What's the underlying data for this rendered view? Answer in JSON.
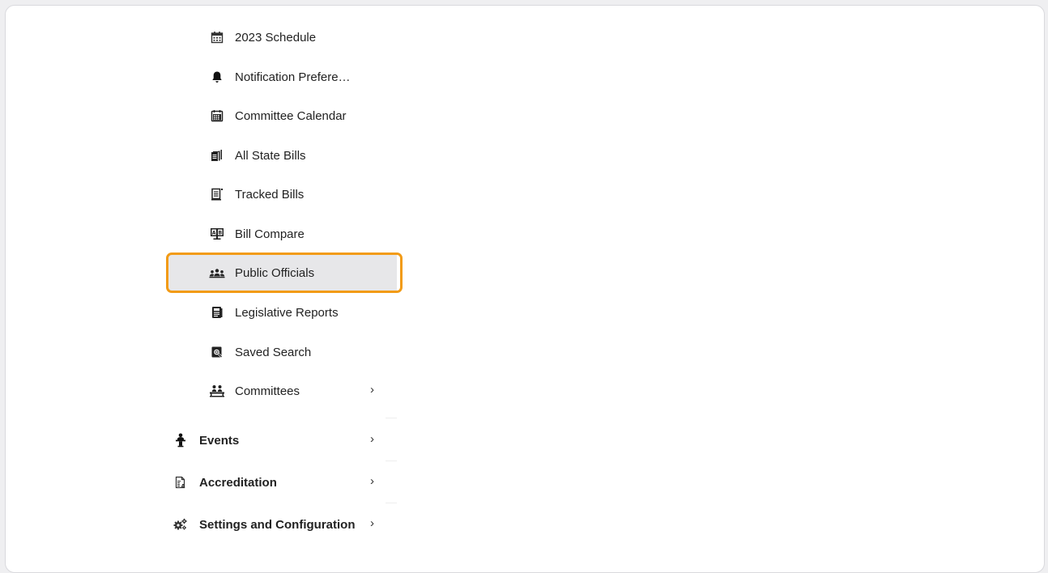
{
  "menu": {
    "items": [
      {
        "label": "2023 Schedule",
        "icon": "calendar-icon"
      },
      {
        "label": "Notification Prefere…",
        "icon": "bell-icon"
      },
      {
        "label": "Committee Calendar",
        "icon": "calendar-grid-icon"
      },
      {
        "label": "All State Bills",
        "icon": "documents-stack-icon"
      },
      {
        "label": "Tracked Bills",
        "icon": "document-tracked-icon"
      },
      {
        "label": "Bill Compare",
        "icon": "compare-ab-icon"
      },
      {
        "label": "Public Officials",
        "icon": "people-group-icon",
        "active": true
      },
      {
        "label": "Legislative Reports",
        "icon": "report-icon"
      },
      {
        "label": "Saved Search",
        "icon": "saved-search-icon"
      },
      {
        "label": "Committees",
        "icon": "committee-icon",
        "chevron": "›"
      }
    ],
    "sections": [
      {
        "label": "Events",
        "icon": "speaker-podium-icon",
        "chevron": "›"
      },
      {
        "label": "Accreditation",
        "icon": "accreditation-doc-icon",
        "chevron": "›"
      },
      {
        "label": "Settings and Configuration",
        "icon": "gears-icon",
        "chevron": "›"
      }
    ]
  },
  "colors": {
    "highlight": "#f29b16",
    "active_bg": "#e7e7e9"
  }
}
